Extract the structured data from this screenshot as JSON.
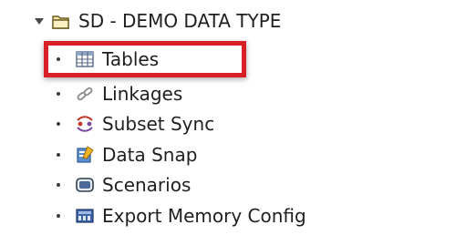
{
  "tree": {
    "root": {
      "label": "SD - DEMO DATA TYPE",
      "icon": "folder-open-icon",
      "expanded": true
    },
    "items": [
      {
        "label": "Tables",
        "icon": "table-icon",
        "highlighted": true
      },
      {
        "label": "Linkages",
        "icon": "link-icon"
      },
      {
        "label": "Subset Sync",
        "icon": "subset-sync-icon"
      },
      {
        "label": "Data Snap",
        "icon": "data-snap-icon"
      },
      {
        "label": "Scenarios",
        "icon": "scenarios-icon"
      },
      {
        "label": "Export Memory Config",
        "icon": "export-memory-config-icon"
      }
    ]
  },
  "colors": {
    "highlight_border": "#d81f26",
    "text": "#1f1f1f"
  }
}
